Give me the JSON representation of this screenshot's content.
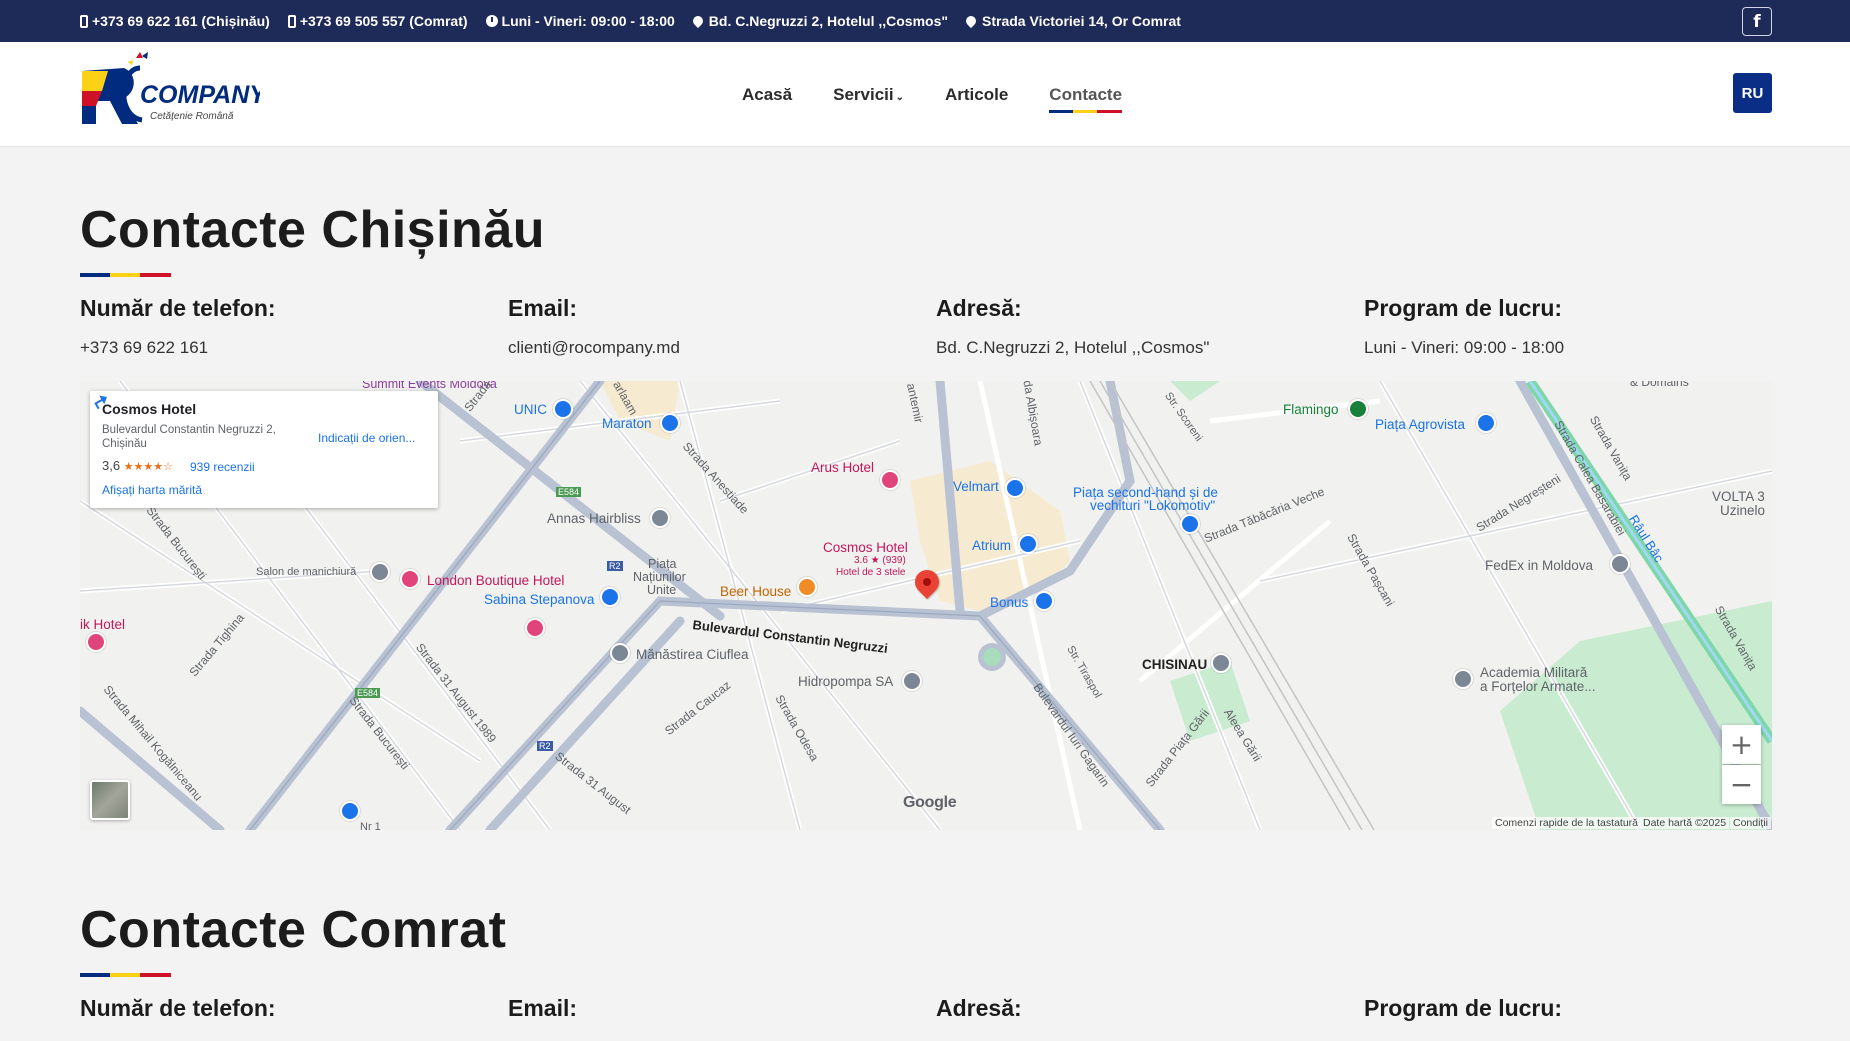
{
  "topbar": {
    "phone1": "+373 69 622 161 (Chișinău)",
    "phone2": "+373 69 505 557 (Comrat)",
    "hours": "Luni - Vineri: 09:00 - 18:00",
    "address1": "Bd. C.Negruzzi 2, Hotelul ,,Cosmos\"",
    "address2": "Strada Victoriei 14, Or Comrat",
    "facebook_label": "f"
  },
  "header": {
    "logo_text": "COMPANY",
    "logo_sub": "Cetățenie Română",
    "logo_letter": "R",
    "nav": [
      "Acasă",
      "Servicii",
      "Articole",
      "Contacte"
    ],
    "lang_button": "RU"
  },
  "chisinau": {
    "title": "Contacte Chișinău",
    "phone_label": "Număr de telefon:",
    "phone": "+373 69 622 161",
    "email_label": "Email:",
    "email": "clienti@rocompany.md",
    "address_label": "Adresă:",
    "address": "Bd. C.Negruzzi 2, Hotelul ,,Cosmos\"",
    "hours_label": "Program de lucru:",
    "hours": "Luni - Vineri: 09:00 - 18:00"
  },
  "map": {
    "infobox": {
      "title": "Cosmos Hotel",
      "address": "Bulevardul Constantin Negruzzi 2, Chișinău",
      "rating": "3,6",
      "reviews": "939 recenzii",
      "bigger_map": "Afișați harta mărită",
      "directions": "Indicații de orien..."
    },
    "labels": {
      "summit": "Summit Events Moldova",
      "unic": "UNIC",
      "maraton": "Maraton",
      "arus": "Arus Hotel",
      "velmart": "Velmart",
      "piata_second": "Piața second-hand și de",
      "piata_second2": "vechituri \"Lokomotiv\"",
      "flamingo": "Flamingo",
      "agrovista": "Piața Agrovista",
      "annas": "Annas Hairbliss",
      "cosmos": "Cosmos Hotel",
      "cosmos_rating": "3.6 ★ (939)",
      "cosmos_type": "Hotel de 3 stele",
      "atrium": "Atrium",
      "beer": "Beer House",
      "bonus": "Bonus",
      "salon": "Salon de manichiură",
      "london": "London Boutique Hotel",
      "sabina": "Sabina Stepanova",
      "piata_unirii": "Piața",
      "piata_unirii2": "Națiunilor",
      "piata_unirii3": "Unite",
      "ik_hotel": "ik Hotel",
      "manastirea": "Mănăstirea Ciuflea",
      "hidropompa": "Hidropompa SA",
      "chisinau_station": "CHISINAU",
      "fedex": "FedEx in Moldova",
      "academia": "Academia Militară",
      "academia2": "a Forțelor Armate...",
      "volta": "VOLTA 3",
      "volta2": "Uzinelo",
      "domains": "& Domains",
      "bd_negruzzi": "Bulevardul Constantin Negruzzi",
      "str_bucuresti": "Strada București",
      "str_bucuresti2": "Strada București",
      "str_31aug": "Strada 31 August 1989",
      "str_31aug2": "Strada 31 August",
      "str_tighina": "Strada Tighina",
      "str_kogalniceanu": "Strada Mihail Kogălniceanu",
      "str_anestiade": "Strada Anestiade",
      "str_caucaz": "Strada Caucaz",
      "str_odesa": "Strada Odesa",
      "str_tabacaria": "Strada Tăbăcăria Veche",
      "str_pascani": "Strada Pașcani",
      "str_negresteni": "Strada Negreșteni",
      "str_basarabiei": "Strada Calea Basarabiei",
      "str_vanita": "Strada Vanița",
      "str_scoreni": "Str. Scoreni",
      "str_tiraspol": "Str. Tiraspol",
      "str_piata_garii": "Strada Piața Gării",
      "aleea_garii": "Aleea Gării",
      "bd_gagarin": "Bulevardul Iuri Gagarin",
      "str_albisoara": "da Albișoara",
      "str_ismail": "antemir",
      "raul_bac": "Râul Bâc",
      "strada": "Strada",
      "arlaam": "arlaam",
      "nr1": "Nr 1",
      "e584": "E584",
      "r2": "R2"
    },
    "google": "Google",
    "attrib_shortcuts": "Comenzi rapide de la tastatură",
    "attrib_data": "Date hartă ©2025",
    "attrib_terms": "Condiții",
    "zoom_in": "+",
    "zoom_out": "−"
  },
  "comrat": {
    "title": "Contacte Comrat",
    "phone_label": "Număr de telefon:",
    "email_label": "Email:",
    "address_label": "Adresă:",
    "hours_label": "Program de lucru:"
  },
  "colors": {
    "topbar_bg": "#1e2a57",
    "accent_blue": "#002b7f",
    "accent_yellow": "#fcd116",
    "accent_red": "#ce1126",
    "lang_bg": "#0a2e86"
  }
}
